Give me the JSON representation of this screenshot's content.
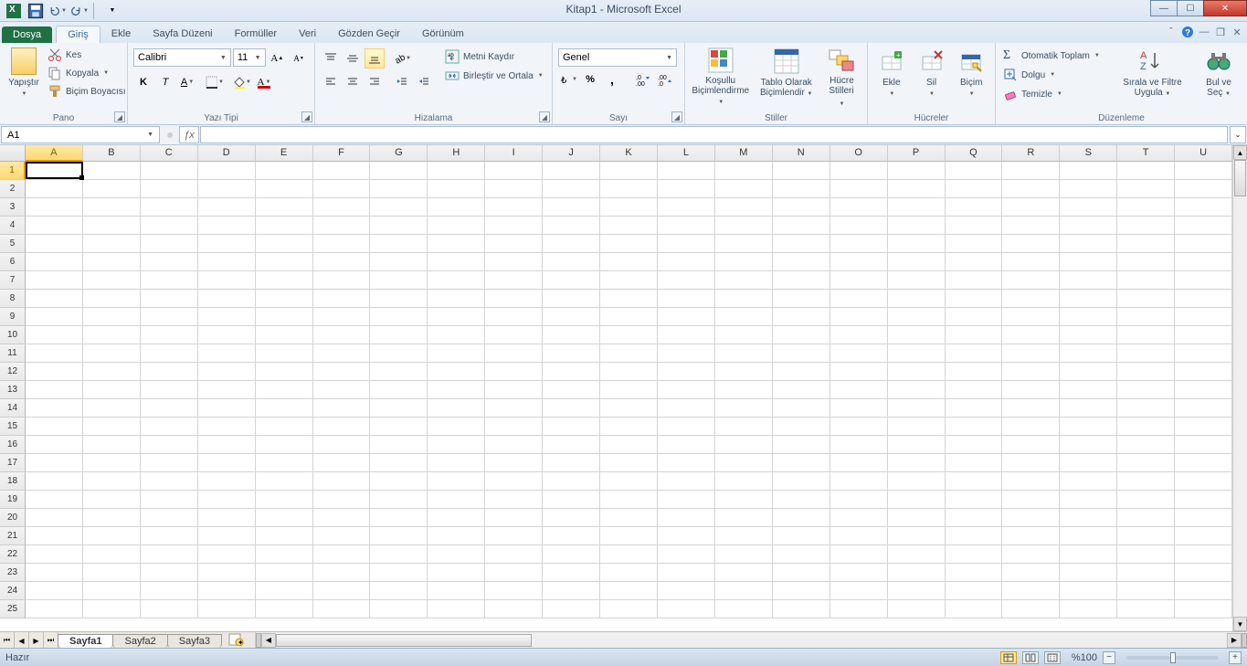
{
  "title": "Kitap1  -  Microsoft Excel",
  "tabs": {
    "file": "Dosya",
    "list": [
      "Giriş",
      "Ekle",
      "Sayfa Düzeni",
      "Formüller",
      "Veri",
      "Gözden Geçir",
      "Görünüm"
    ],
    "activeIndex": 0
  },
  "clipboard": {
    "paste": "Yapıştır",
    "cut": "Kes",
    "copy": "Kopyala",
    "painter": "Biçim Boyacısı",
    "group": "Pano"
  },
  "font": {
    "name": "Calibri",
    "size": "11",
    "group": "Yazı Tipi"
  },
  "alignment": {
    "wrap": "Metni Kaydır",
    "merge": "Birleştir ve Ortala",
    "group": "Hizalama"
  },
  "number": {
    "format": "Genel",
    "group": "Sayı"
  },
  "styles": {
    "cond": "Koşullu Biçimlendirme",
    "table": "Tablo Olarak Biçimlendir",
    "cell": "Hücre Stilleri",
    "group": "Stiller"
  },
  "cells": {
    "insert": "Ekle",
    "delete": "Sil",
    "format": "Biçim",
    "group": "Hücreler"
  },
  "editing": {
    "autosum": "Otomatik Toplam",
    "fill": "Dolgu",
    "clear": "Temizle",
    "sort": "Sırala ve Filtre Uygula",
    "find": "Bul ve Seç",
    "group": "Düzenleme"
  },
  "namebox": "A1",
  "columns": [
    "A",
    "B",
    "C",
    "D",
    "E",
    "F",
    "G",
    "H",
    "I",
    "J",
    "K",
    "L",
    "M",
    "N",
    "O",
    "P",
    "Q",
    "R",
    "S",
    "T",
    "U"
  ],
  "rows": [
    "1",
    "2",
    "3",
    "4",
    "5",
    "6",
    "7",
    "8",
    "9",
    "10",
    "11",
    "12",
    "13",
    "14",
    "15",
    "16",
    "17",
    "18",
    "19",
    "20",
    "21",
    "22",
    "23",
    "24",
    "25"
  ],
  "sheets": [
    "Sayfa1",
    "Sayfa2",
    "Sayfa3"
  ],
  "activeSheet": 0,
  "status": "Hazır",
  "zoom": "%100"
}
